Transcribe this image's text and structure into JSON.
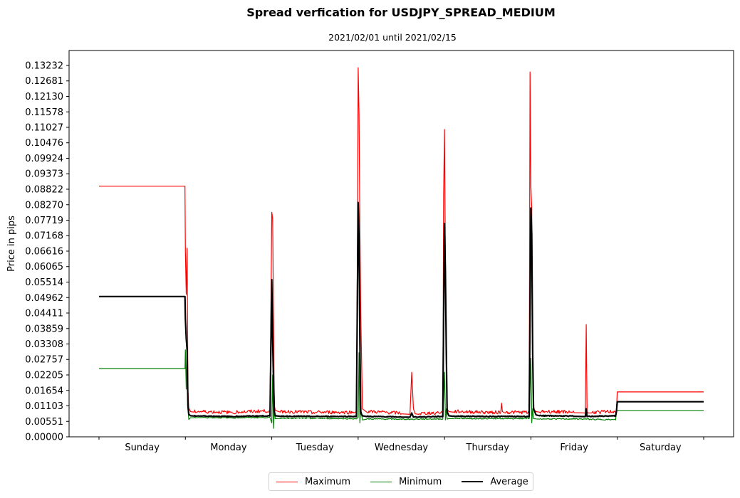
{
  "chart_data": {
    "type": "line",
    "title": "Spread verfication for USDJPY_SPREAD_MEDIUM",
    "subtitle": "2021/02/01 until 2021/02/15",
    "xlabel": "",
    "ylabel": "Price in pips",
    "ylim": [
      0,
      0.1345
    ],
    "xlim": [
      -0.346,
      7.346
    ],
    "yticks": [
      "0.00000",
      "0.00551",
      "0.01103",
      "0.01654",
      "0.02205",
      "0.02757",
      "0.03308",
      "0.03859",
      "0.04411",
      "0.04962",
      "0.05514",
      "0.06065",
      "0.06616",
      "0.07168",
      "0.07719",
      "0.08270",
      "0.08822",
      "0.09373",
      "0.09924",
      "0.10476",
      "0.11027",
      "0.11578",
      "0.12130",
      "0.12681",
      "0.13232"
    ],
    "ytick_values": [
      0.0,
      0.00551,
      0.01103,
      0.01654,
      0.02205,
      0.02757,
      0.03308,
      0.03859,
      0.04411,
      0.04962,
      0.05514,
      0.06065,
      0.06616,
      0.07168,
      0.07719,
      0.0827,
      0.08822,
      0.09373,
      0.09924,
      0.10476,
      0.11027,
      0.11578,
      0.1213,
      0.12681,
      0.13232
    ],
    "xtick_positions": [
      0,
      1,
      2,
      3,
      4,
      5,
      6,
      7
    ],
    "categories": [
      "Sunday",
      "Monday",
      "Tuesday",
      "Wednesday",
      "Thursday",
      "Friday",
      "Saturday"
    ],
    "grid": false,
    "legend_position": "bottom-center",
    "series": [
      {
        "name": "Maximum",
        "color": "#ff0000",
        "x": [
          0,
          0.995,
          1.0,
          1.01,
          1.02,
          1.03,
          1.04,
          1.06,
          1.1,
          1.5,
          1.7,
          1.98,
          2.0,
          2.01,
          2.02,
          2.03,
          2.04,
          2.06,
          2.1,
          2.5,
          2.95,
          2.98,
          2.99,
          3.0,
          3.01,
          3.02,
          3.03,
          3.05,
          3.1,
          3.5,
          3.6,
          3.62,
          3.64,
          3.66,
          3.7,
          3.98,
          3.99,
          4.0,
          4.01,
          4.02,
          4.03,
          4.05,
          4.1,
          4.5,
          4.65,
          4.66,
          4.67,
          4.7,
          4.98,
          4.99,
          5.0,
          5.01,
          5.02,
          5.03,
          5.04,
          5.06,
          5.1,
          5.5,
          5.63,
          5.64,
          5.65,
          5.66,
          5.7,
          5.98,
          5.99,
          6.0,
          7.0
        ],
        "y": [
          0.0893,
          0.0893,
          0.066,
          0.0508,
          0.0672,
          0.0165,
          0.0102,
          0.009,
          0.0088,
          0.0085,
          0.0087,
          0.009,
          0.08,
          0.078,
          0.042,
          0.011,
          0.0095,
          0.0092,
          0.0088,
          0.0085,
          0.0085,
          0.009,
          0.056,
          0.1315,
          0.115,
          0.075,
          0.044,
          0.01,
          0.0088,
          0.0082,
          0.008,
          0.023,
          0.01,
          0.0082,
          0.008,
          0.0085,
          0.087,
          0.1095,
          0.062,
          0.039,
          0.01,
          0.009,
          0.0088,
          0.0085,
          0.0085,
          0.012,
          0.009,
          0.0085,
          0.0085,
          0.13,
          0.089,
          0.0815,
          0.033,
          0.011,
          0.0095,
          0.009,
          0.0088,
          0.0086,
          0.0085,
          0.04,
          0.009,
          0.0085,
          0.0085,
          0.0088,
          0.0095,
          0.016,
          0.016
        ]
      },
      {
        "name": "Minimum",
        "color": "#008000",
        "x": [
          0,
          0.995,
          1.0,
          1.01,
          1.02,
          1.03,
          1.04,
          1.06,
          1.1,
          1.5,
          1.98,
          2.0,
          2.01,
          2.02,
          2.03,
          2.04,
          2.1,
          2.5,
          2.98,
          3.0,
          3.01,
          3.02,
          3.03,
          3.05,
          3.1,
          3.5,
          3.98,
          4.0,
          4.01,
          4.02,
          4.03,
          4.05,
          4.1,
          4.5,
          4.98,
          5.0,
          5.01,
          5.02,
          5.03,
          5.06,
          5.1,
          5.5,
          5.98,
          5.99,
          6.0,
          7.0
        ],
        "y": [
          0.0243,
          0.0243,
          0.031,
          0.017,
          0.03,
          0.01,
          0.0062,
          0.0068,
          0.0068,
          0.0067,
          0.0068,
          0.005,
          0.022,
          0.003,
          0.01,
          0.0065,
          0.0066,
          0.0065,
          0.0064,
          0.007,
          0.03,
          0.005,
          0.01,
          0.006,
          0.0063,
          0.0062,
          0.0063,
          0.023,
          0.006,
          0.01,
          0.0063,
          0.0065,
          0.0065,
          0.0064,
          0.0065,
          0.028,
          0.005,
          0.01,
          0.0065,
          0.0064,
          0.0063,
          0.0063,
          0.006,
          0.009,
          0.0093,
          0.0093
        ]
      },
      {
        "name": "Average",
        "color": "#000000",
        "x": [
          0,
          0.995,
          1.0,
          1.01,
          1.02,
          1.03,
          1.04,
          1.06,
          1.1,
          1.5,
          1.98,
          2.0,
          2.01,
          2.02,
          2.03,
          2.04,
          2.1,
          2.5,
          2.98,
          3.0,
          3.01,
          3.02,
          3.03,
          3.04,
          3.05,
          3.1,
          3.5,
          3.6,
          3.62,
          3.64,
          3.98,
          4.0,
          4.01,
          4.02,
          4.03,
          4.05,
          4.1,
          4.5,
          4.98,
          5.0,
          5.01,
          5.02,
          5.03,
          5.06,
          5.1,
          5.5,
          5.63,
          5.64,
          5.65,
          5.98,
          5.99,
          6.0,
          7.0
        ],
        "y": [
          0.05,
          0.05,
          0.042,
          0.035,
          0.031,
          0.011,
          0.008,
          0.0075,
          0.0074,
          0.0072,
          0.0074,
          0.056,
          0.035,
          0.02,
          0.009,
          0.0075,
          0.0073,
          0.0072,
          0.0072,
          0.0835,
          0.07,
          0.034,
          0.009,
          0.008,
          0.0075,
          0.0072,
          0.007,
          0.007,
          0.0085,
          0.007,
          0.0072,
          0.076,
          0.058,
          0.031,
          0.009,
          0.0075,
          0.0073,
          0.0072,
          0.0072,
          0.0815,
          0.072,
          0.03,
          0.01,
          0.0078,
          0.0075,
          0.0073,
          0.0072,
          0.01,
          0.0072,
          0.0074,
          0.009,
          0.0125,
          0.0125
        ]
      }
    ]
  },
  "legend": {
    "items": [
      {
        "label": "Maximum",
        "color": "#ff0000"
      },
      {
        "label": "Minimum",
        "color": "#008000"
      },
      {
        "label": "Average",
        "color": "#000000"
      }
    ]
  }
}
